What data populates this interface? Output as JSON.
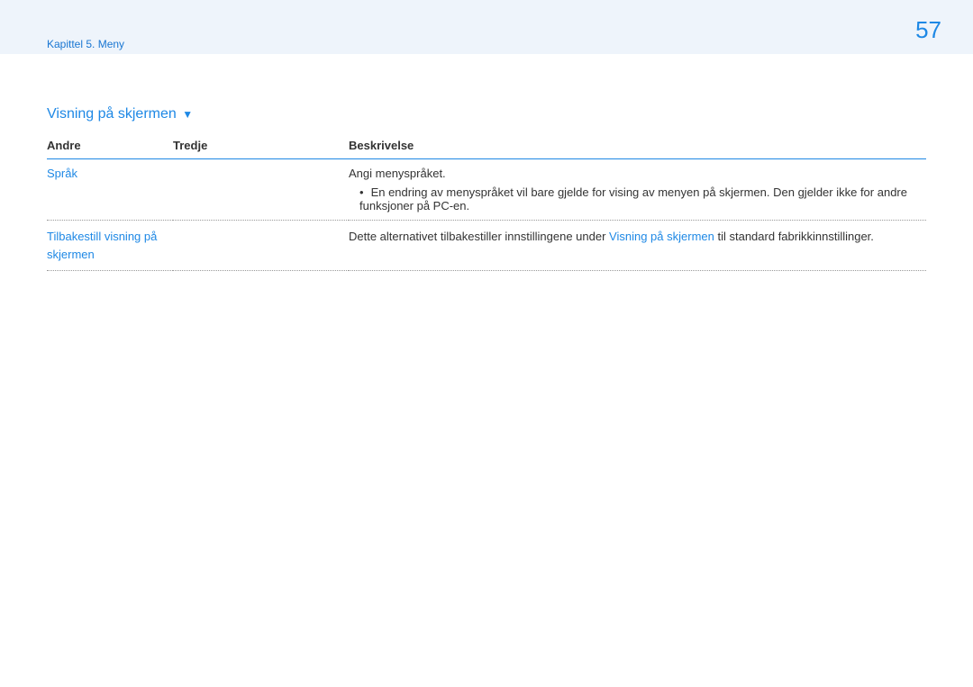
{
  "header": {
    "breadcrumb": "Kapittel 5. Meny",
    "page_number": "57"
  },
  "section": {
    "title": "Visning på skjermen",
    "arrow": "▼"
  },
  "table": {
    "headers": {
      "col1": "Andre",
      "col2": "Tredje",
      "col3": "Beskrivelse"
    },
    "rows": [
      {
        "andre": "Språk",
        "tredje": "",
        "beskrivelse_line1": "Angi menyspråket.",
        "beskrivelse_bullet": "En endring av menyspråket vil bare gjelde for vising av menyen på skjermen. Den gjelder ikke for andre funksjoner på PC-en."
      },
      {
        "andre_line1": "Tilbakestill visning på",
        "andre_line2": "skjermen",
        "tredje": "",
        "beskrivelse_part1": "Dette alternativet tilbakestiller innstillingene under ",
        "beskrivelse_link": "Visning på skjermen",
        "beskrivelse_part2": " til standard fabrikkinnstillinger."
      }
    ]
  }
}
